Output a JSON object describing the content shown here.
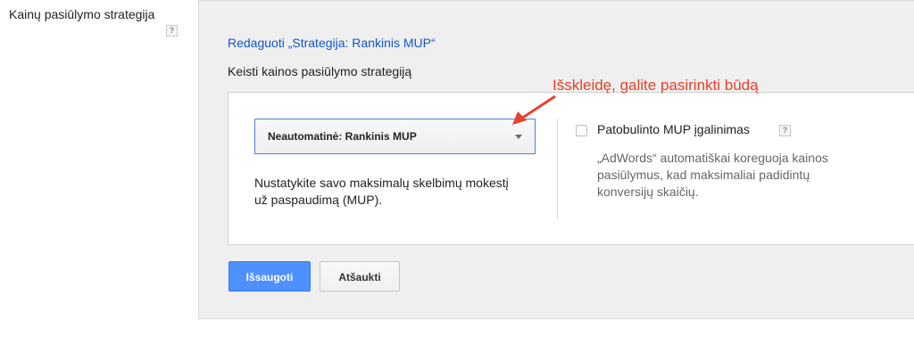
{
  "left": {
    "label": "Kainų pasiūlymo strategija",
    "help_icon": "?"
  },
  "panel": {
    "edit_link": "Redaguoti „Strategija: Rankinis MUP“",
    "subtitle": "Keisti kainos pasiūlymo strategiją",
    "annotation": "Išskleidę, galite pasirinkti būdą",
    "annotation_color": "#e8402a",
    "strategy_select": {
      "selected": "Neautomatinė: Rankinis MUP",
      "icon": "chevron-down-icon"
    },
    "description": "Nustatykite savo maksimalų skelbimų mokestį už paspaudimą (MUP).",
    "enhanced_cpc": {
      "label": "Patobulinto MUP įgalinimas",
      "help_icon": "?",
      "checked": false,
      "description": "„AdWords“ automatiškai koreguoja kainos pasiūlymus, kad maksimaliai padidintų konversijų skaičių."
    },
    "buttons": {
      "save": "Išsaugoti",
      "cancel": "Atšaukti"
    },
    "colors": {
      "link": "#1155cc",
      "primary_button": "#4d90fe",
      "panel_bg": "#efefef"
    }
  }
}
